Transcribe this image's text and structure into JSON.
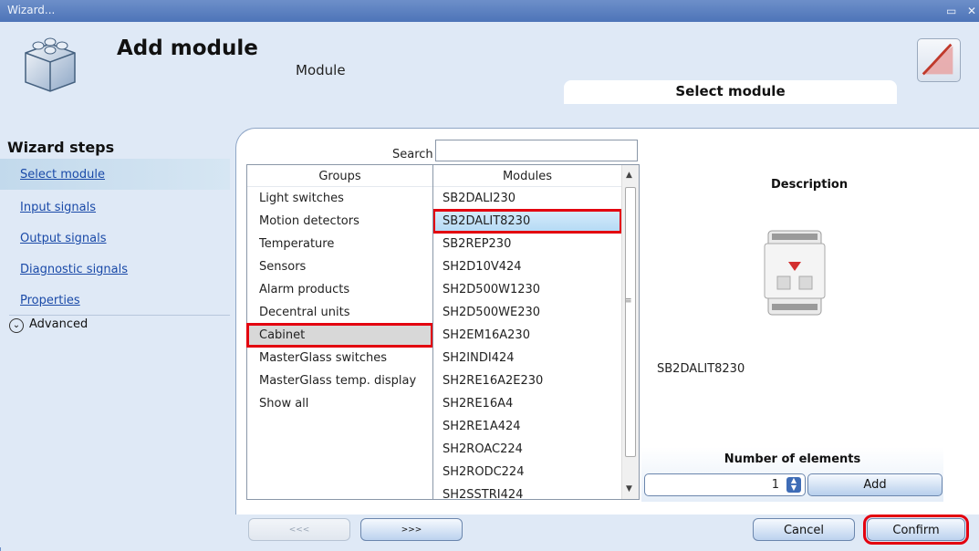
{
  "window": {
    "title": "Wizard...",
    "restore_glyph": "▭",
    "close_glyph": "✕"
  },
  "header": {
    "title": "Add module",
    "subtitle": "Module",
    "current_step_tab": "Select module"
  },
  "sidebar": {
    "heading": "Wizard steps",
    "steps": [
      {
        "label": "Select module",
        "active": true
      },
      {
        "label": "Input signals",
        "active": false
      },
      {
        "label": "Output signals",
        "active": false
      },
      {
        "label": "Diagnostic signals",
        "active": false
      },
      {
        "label": "Properties",
        "active": false
      }
    ],
    "advanced_label": "Advanced",
    "advanced_icon": "chevron-down-circle-icon"
  },
  "search": {
    "label": "Search",
    "value": ""
  },
  "groups": {
    "header": "Groups",
    "selected": "Cabinet",
    "items": [
      "Light switches",
      "Motion detectors",
      "Temperature",
      "Sensors",
      "Alarm products",
      "Decentral units",
      "Cabinet",
      "MasterGlass switches",
      "MasterGlass temp. display",
      "Show all"
    ]
  },
  "modules": {
    "header": "Modules",
    "selected": "SB2DALIT8230",
    "items": [
      "SB2DALI230",
      "SB2DALIT8230",
      "SB2REP230",
      "SH2D10V424",
      "SH2D500W1230",
      "SH2D500WE230",
      "SH2EM16A230",
      "SH2INDI424",
      "SH2RE16A2E230",
      "SH2RE16A4",
      "SH2RE1A424",
      "SH2ROAC224",
      "SH2RODC224",
      "SH2SSTRI424"
    ]
  },
  "description": {
    "title": "Description",
    "selected_module": "SB2DALIT8230"
  },
  "number_of_elements": {
    "title": "Number of elements",
    "value": "1",
    "add_label": "Add"
  },
  "footer": {
    "back_label": "<<<",
    "next_label": ">>>",
    "cancel_label": "Cancel",
    "confirm_label": "Confirm"
  },
  "colors": {
    "accent": "#3e6cb6",
    "highlight": "#e3000f",
    "panel": "#dfe9f6"
  }
}
